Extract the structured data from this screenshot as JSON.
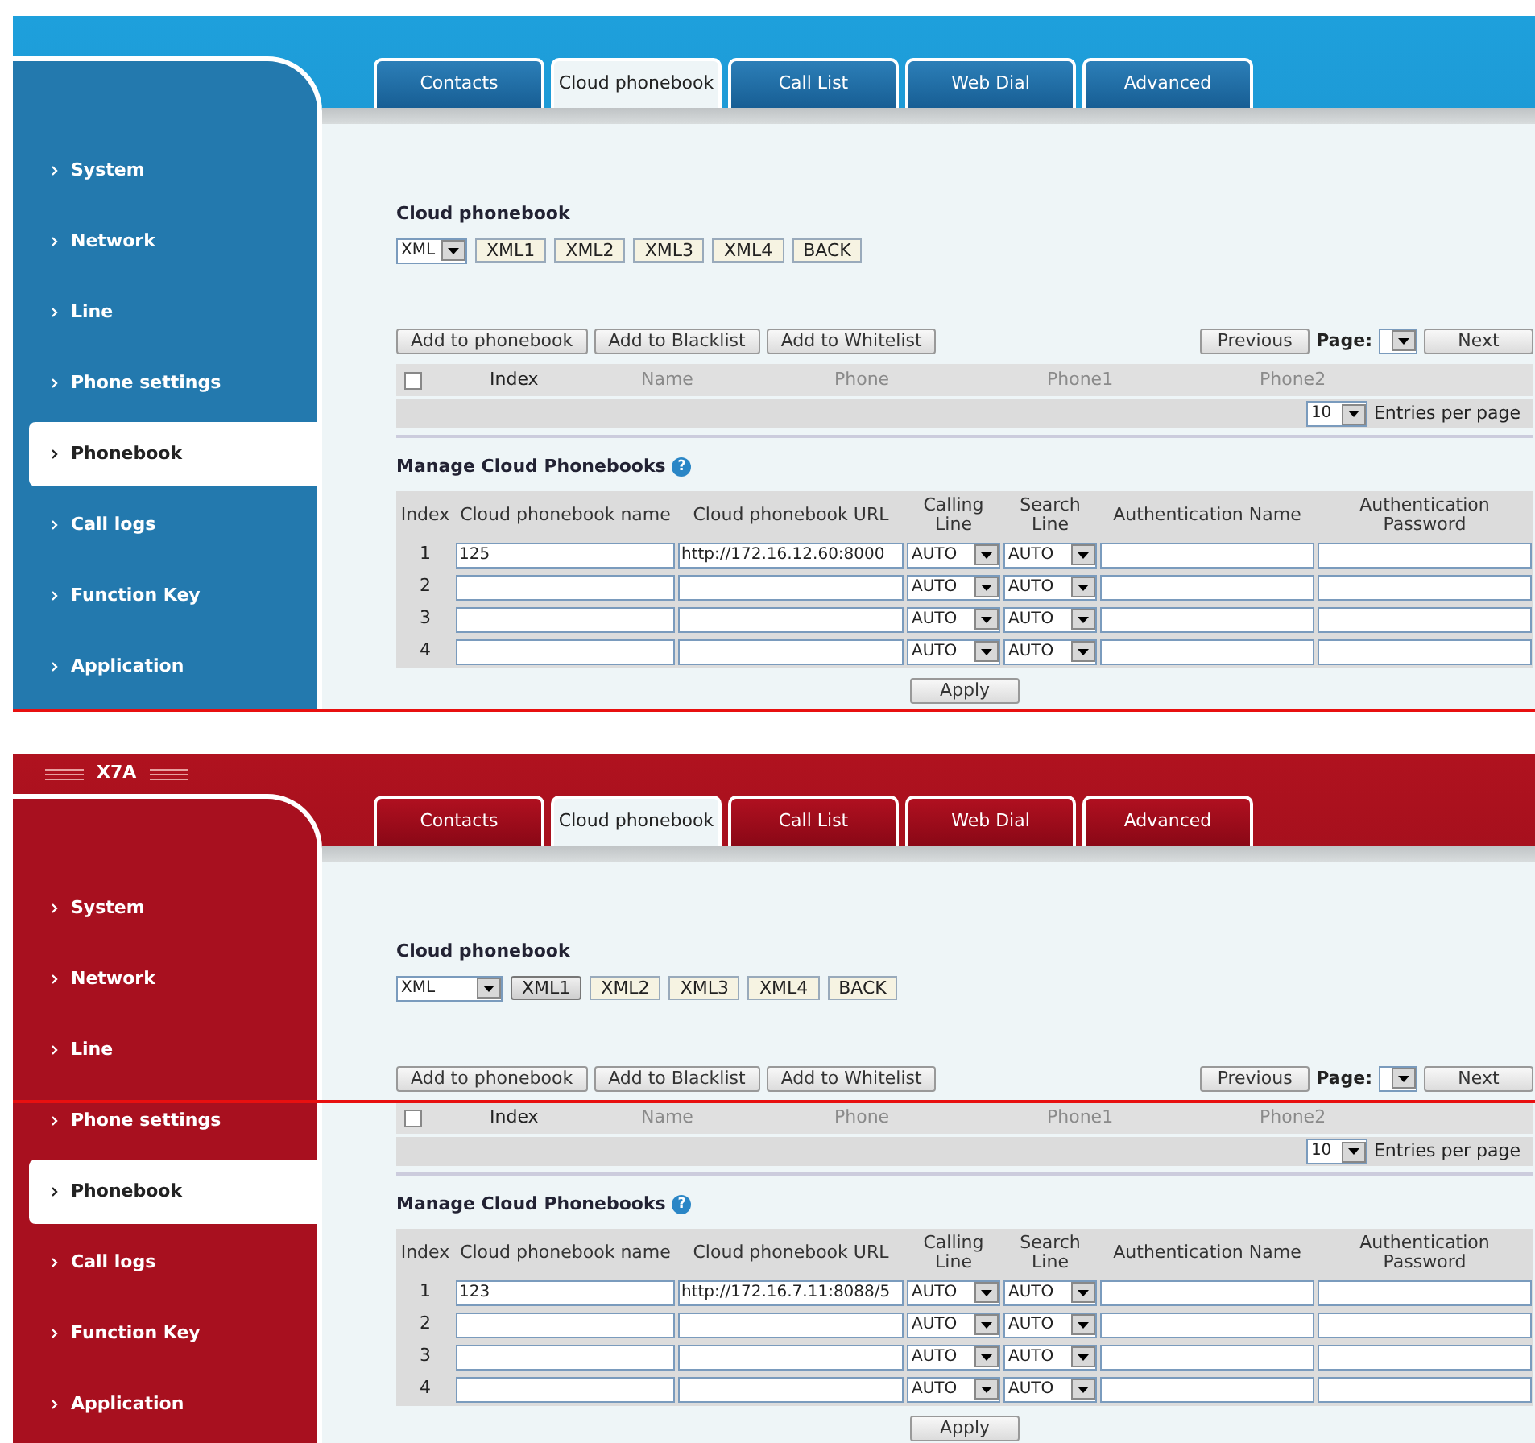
{
  "panels": [
    {
      "kind": "blue",
      "sidebar": [
        {
          "label": "System",
          "selected": false
        },
        {
          "label": "Network",
          "selected": false
        },
        {
          "label": "Line",
          "selected": false
        },
        {
          "label": "Phone settings",
          "selected": false
        },
        {
          "label": "Phonebook",
          "selected": true
        },
        {
          "label": "Call logs",
          "selected": false
        },
        {
          "label": "Function Key",
          "selected": false
        },
        {
          "label": "Application",
          "selected": false
        }
      ],
      "tabs": [
        {
          "label": "Contacts",
          "selected": false
        },
        {
          "label": "Cloud phonebook",
          "selected": true
        },
        {
          "label": "Call List",
          "selected": false
        },
        {
          "label": "Web Dial",
          "selected": false
        },
        {
          "label": "Advanced",
          "selected": false
        }
      ],
      "section_title": "Cloud phonebook",
      "source_select": "XML",
      "source_buttons": [
        {
          "label": "XML1",
          "selected": false
        },
        {
          "label": "XML2",
          "selected": false
        },
        {
          "label": "XML3",
          "selected": false
        },
        {
          "label": "XML4",
          "selected": false
        },
        {
          "label": "BACK",
          "selected": false
        }
      ],
      "actions": [
        "Add to phonebook",
        "Add to Blacklist",
        "Add to Whitelist"
      ],
      "pager": {
        "previous": "Previous",
        "page_label": "Page:",
        "next": "Next"
      },
      "contacts_columns": [
        {
          "label": "Index",
          "disabled": false
        },
        {
          "label": "Name",
          "disabled": true
        },
        {
          "label": "Phone",
          "disabled": true
        },
        {
          "label": "Phone1",
          "disabled": true
        },
        {
          "label": "Phone2",
          "disabled": true
        }
      ],
      "select_all_checked": false,
      "per_page": {
        "value": "10",
        "label": "Entries per page"
      },
      "manage": {
        "title": "Manage Cloud Phonebooks",
        "help_icon": "?",
        "columns": [
          "Index",
          "Cloud phonebook name",
          "Cloud phonebook URL",
          "Calling Line",
          "Search Line",
          "Authentication Name",
          "Authentication Password"
        ],
        "rows": [
          {
            "index": "1",
            "name": "125",
            "url": "http://172.16.12.60:8000",
            "calling_line": "AUTO",
            "search_line": "AUTO"
          },
          {
            "index": "2",
            "calling_line": "AUTO",
            "search_line": "AUTO"
          },
          {
            "index": "3",
            "calling_line": "AUTO",
            "search_line": "AUTO"
          },
          {
            "index": "4",
            "calling_line": "AUTO",
            "search_line": "AUTO"
          }
        ],
        "apply": "Apply"
      }
    },
    {
      "kind": "red",
      "brand": "X7A",
      "sidebar": [
        {
          "label": "System",
          "selected": false
        },
        {
          "label": "Network",
          "selected": false
        },
        {
          "label": "Line",
          "selected": false
        },
        {
          "label": "Phone settings",
          "selected": false
        },
        {
          "label": "Phonebook",
          "selected": true
        },
        {
          "label": "Call logs",
          "selected": false
        },
        {
          "label": "Function Key",
          "selected": false
        },
        {
          "label": "Application",
          "selected": false
        }
      ],
      "tabs": [
        {
          "label": "Contacts",
          "selected": false
        },
        {
          "label": "Cloud phonebook",
          "selected": true
        },
        {
          "label": "Call List",
          "selected": false
        },
        {
          "label": "Web Dial",
          "selected": false
        },
        {
          "label": "Advanced",
          "selected": false
        }
      ],
      "section_title": "Cloud phonebook",
      "source_select": "XML",
      "source_buttons": [
        {
          "label": "XML1",
          "selected": true
        },
        {
          "label": "XML2",
          "selected": false
        },
        {
          "label": "XML3",
          "selected": false
        },
        {
          "label": "XML4",
          "selected": false
        },
        {
          "label": "BACK",
          "selected": false
        }
      ],
      "actions": [
        "Add to phonebook",
        "Add to Blacklist",
        "Add to Whitelist"
      ],
      "pager": {
        "previous": "Previous",
        "page_label": "Page:",
        "next": "Next"
      },
      "contacts_columns": [
        {
          "label": "Index",
          "disabled": false
        },
        {
          "label": "Name",
          "disabled": true
        },
        {
          "label": "Phone",
          "disabled": true
        },
        {
          "label": "Phone1",
          "disabled": true
        },
        {
          "label": "Phone2",
          "disabled": true
        }
      ],
      "select_all_checked": false,
      "per_page": {
        "value": "10",
        "label": "Entries per page"
      },
      "manage": {
        "title": "Manage Cloud Phonebooks",
        "help_icon": "?",
        "columns": [
          "Index",
          "Cloud phonebook name",
          "Cloud phonebook URL",
          "Calling Line",
          "Search Line",
          "Authentication Name",
          "Authentication Password"
        ],
        "rows": [
          {
            "index": "1",
            "name": "123",
            "url": "http://172.16.7.11:8088/5",
            "calling_line": "AUTO",
            "search_line": "AUTO"
          },
          {
            "index": "2",
            "calling_line": "AUTO",
            "search_line": "AUTO"
          },
          {
            "index": "3",
            "calling_line": "AUTO",
            "search_line": "AUTO"
          },
          {
            "index": "4",
            "calling_line": "AUTO",
            "search_line": "AUTO"
          }
        ],
        "apply": "Apply"
      }
    }
  ]
}
